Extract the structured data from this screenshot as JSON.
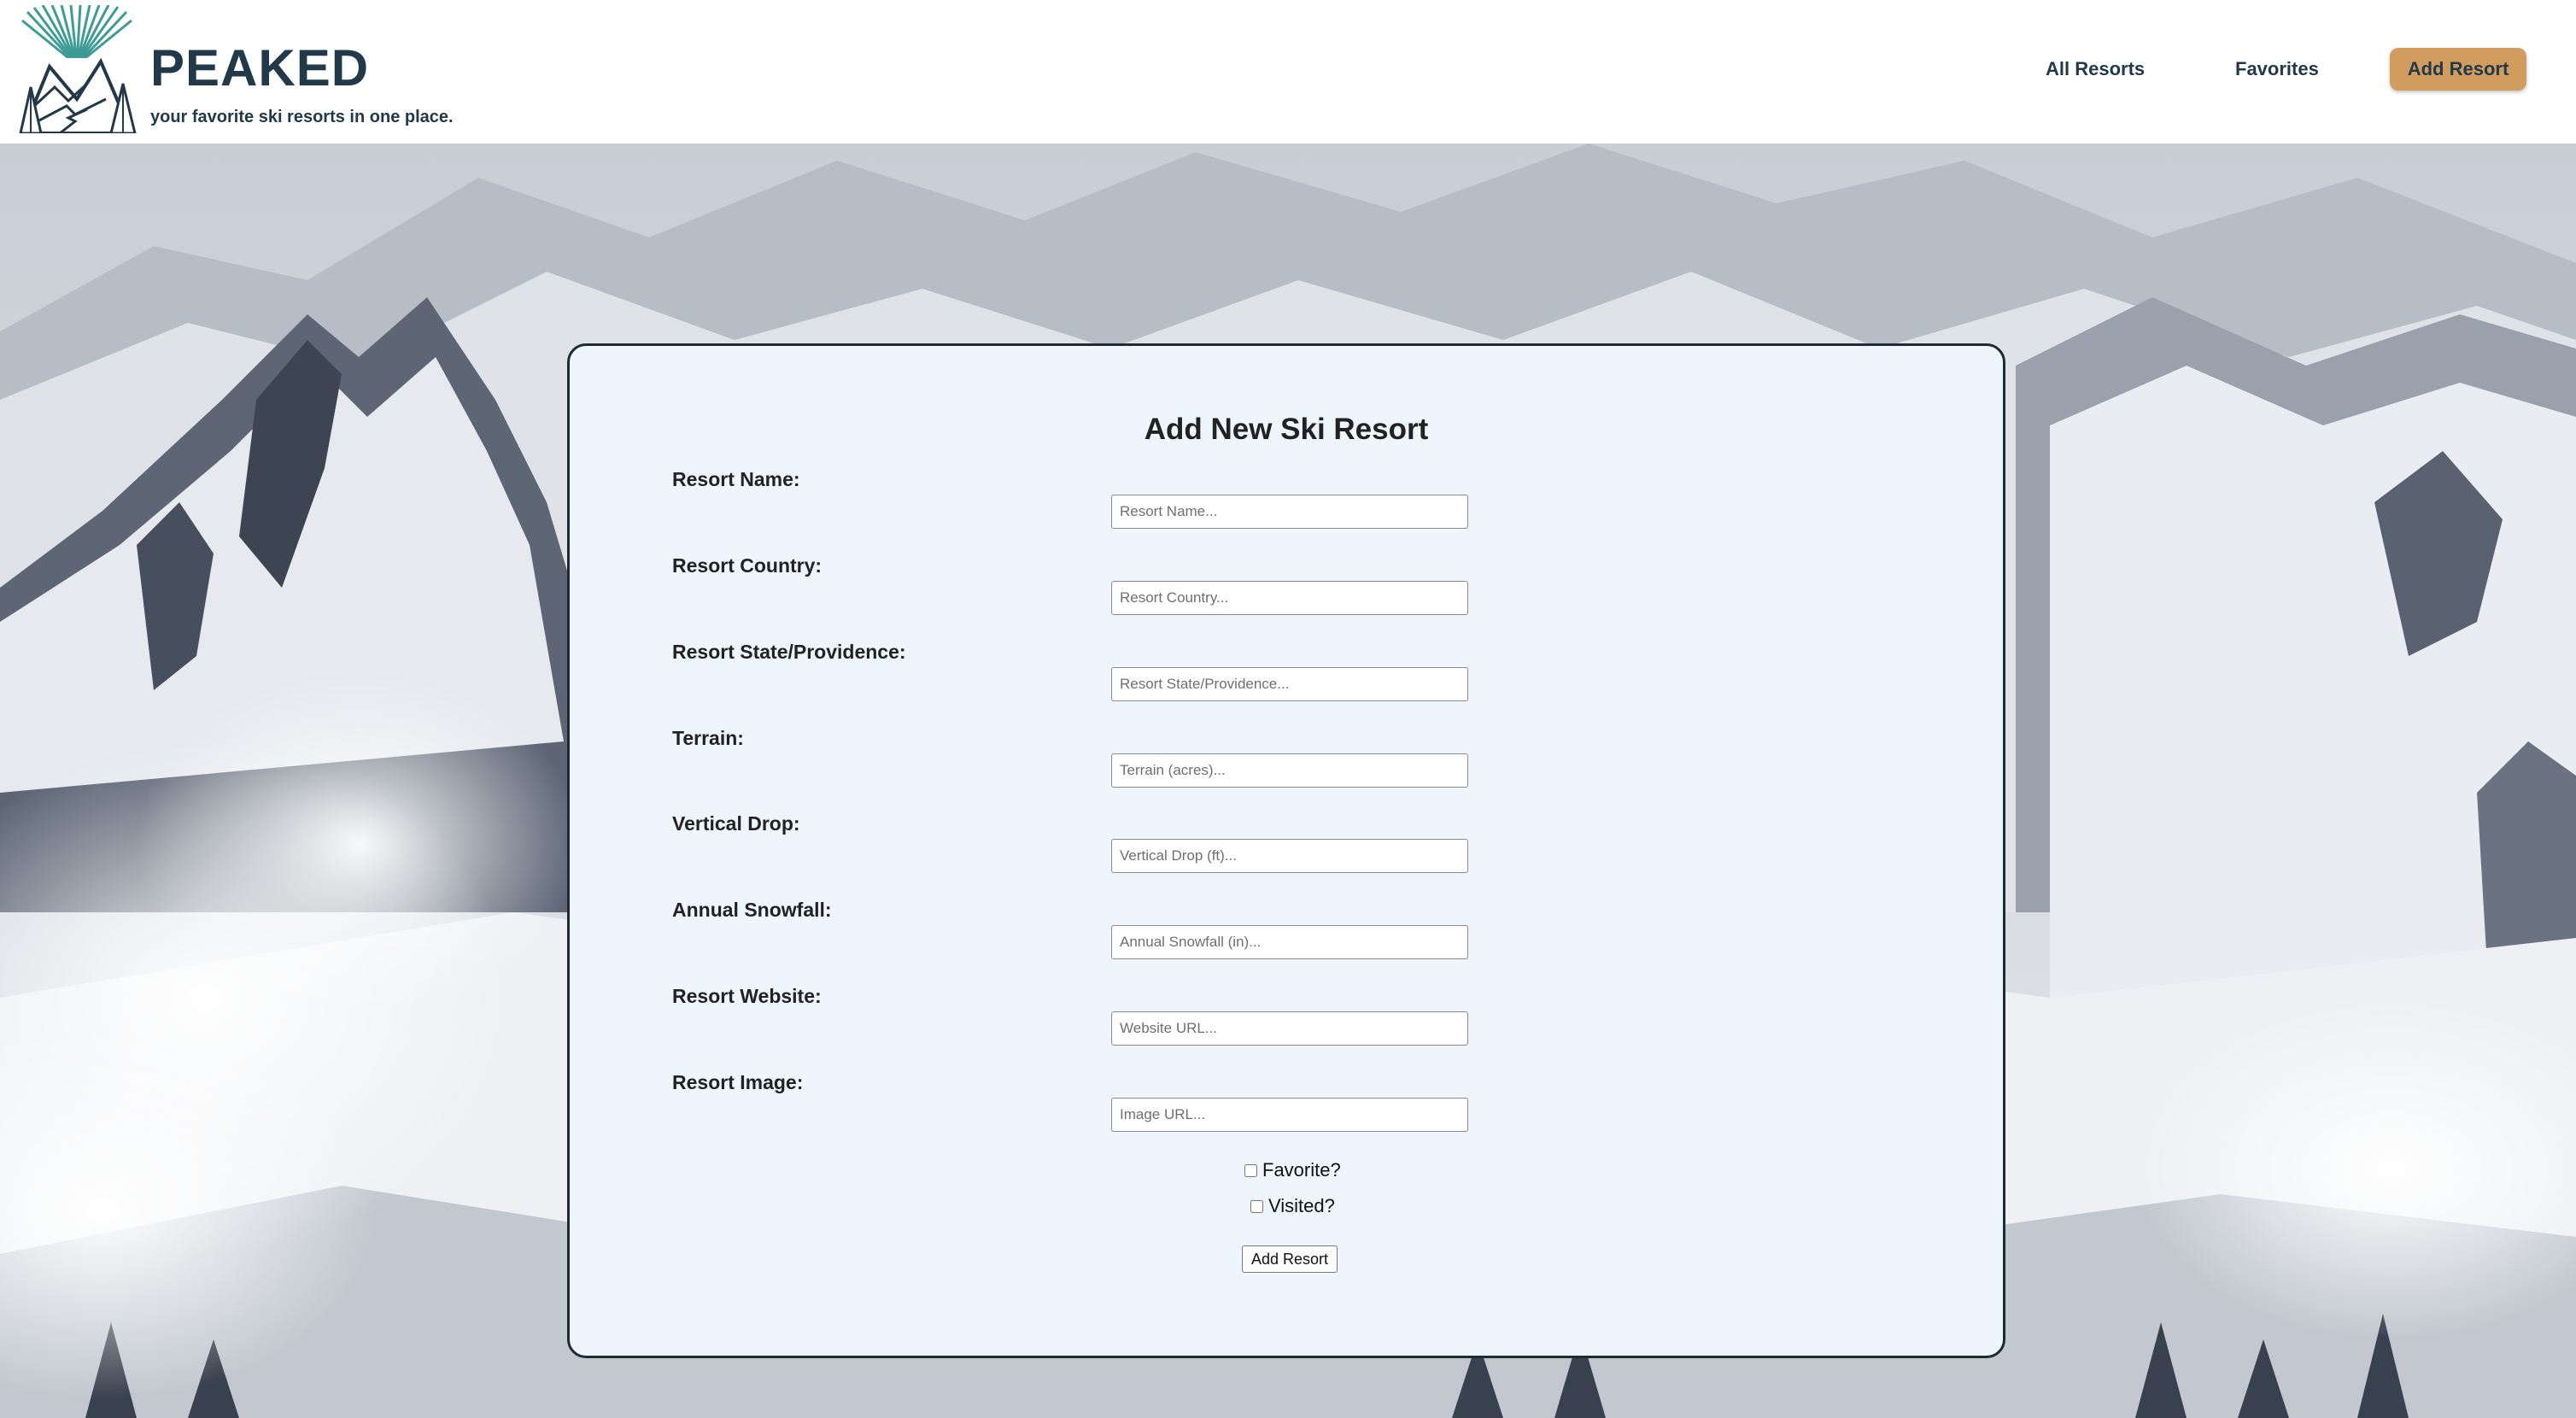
{
  "header": {
    "brand": "PEAKED",
    "tagline": "your favorite ski resorts in one place.",
    "nav": {
      "all_resorts": "All Resorts",
      "favorites": "Favorites",
      "add_resort": "Add Resort"
    }
  },
  "colors": {
    "brand_navy": "#22394a",
    "accent_tan": "#d19d5f",
    "card_bg": "#eef5fc"
  },
  "form": {
    "title": "Add New Ski Resort",
    "fields": [
      {
        "label": "Resort Name:",
        "placeholder": "Resort Name...",
        "value": ""
      },
      {
        "label": "Resort Country:",
        "placeholder": "Resort Country...",
        "value": ""
      },
      {
        "label": "Resort State/Providence:",
        "placeholder": "Resort State/Providence...",
        "value": ""
      },
      {
        "label": "Terrain:",
        "placeholder": "Terrain (acres)...",
        "value": ""
      },
      {
        "label": "Vertical Drop:",
        "placeholder": "Vertical Drop (ft)...",
        "value": ""
      },
      {
        "label": "Annual Snowfall:",
        "placeholder": "Annual Snowfall (in)...",
        "value": ""
      },
      {
        "label": "Resort Website:",
        "placeholder": "Website URL...",
        "value": ""
      },
      {
        "label": "Resort Image:",
        "placeholder": "Image URL...",
        "value": ""
      }
    ],
    "checkboxes": {
      "favorite": {
        "label": "Favorite?",
        "checked": false
      },
      "visited": {
        "label": "Visited?",
        "checked": false
      }
    },
    "submit_label": "Add Resort"
  },
  "icons": {
    "logo": "mountain-sunburst-logo-icon"
  }
}
